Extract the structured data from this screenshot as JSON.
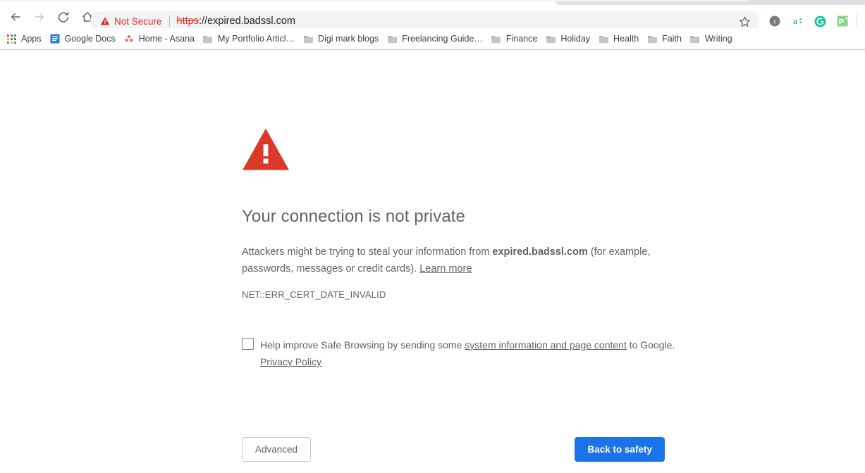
{
  "browser": {
    "nav": {
      "back_label": "Back",
      "forward_label": "Forward",
      "reload_label": "Reload",
      "home_label": "Home"
    },
    "omnibox": {
      "security_label": "Not Secure",
      "url_scheme": "https",
      "url_rest": "://expired.badssl.com",
      "full_url": "https://expired.badssl.com",
      "security_color": "#d93025"
    },
    "star_label": "Bookmark this tab",
    "extensions": [
      {
        "name": "grammarly-dark-icon",
        "glyph": "ŧ"
      },
      {
        "name": "amazon-assistant-icon",
        "glyph": "a"
      },
      {
        "name": "grammarly-icon",
        "glyph": "G"
      },
      {
        "name": "pinterest-save-icon",
        "glyph": "P"
      }
    ],
    "bookmarks": [
      {
        "label": "Apps",
        "icon": "apps-grid-icon"
      },
      {
        "label": "Google Docs",
        "icon": "google-docs-icon"
      },
      {
        "label": "Home - Asana",
        "icon": "asana-icon"
      },
      {
        "label": "My Portfolio Articl…",
        "icon": "folder-icon"
      },
      {
        "label": "Digi mark blogs",
        "icon": "folder-icon"
      },
      {
        "label": "Freelancing Guide…",
        "icon": "folder-icon"
      },
      {
        "label": "Finance",
        "icon": "folder-icon"
      },
      {
        "label": "Holiday",
        "icon": "folder-icon"
      },
      {
        "label": "Health",
        "icon": "folder-icon"
      },
      {
        "label": "Faith",
        "icon": "folder-icon"
      },
      {
        "label": "Writing",
        "icon": "folder-icon"
      }
    ]
  },
  "interstitial": {
    "icon": "red-warning-triangle-icon",
    "icon_color": "#db3a2b",
    "heading": "Your connection is not private",
    "body_part1": "Attackers might be trying to steal your information from ",
    "body_domain": "expired.badssl.com",
    "body_part2": " (for example, passwords, messages or credit cards). ",
    "learn_more": "Learn more",
    "error_code": "NET::ERR_CERT_DATE_INVALID",
    "optin_part1": "Help improve Safe Browsing by sending some ",
    "optin_link": "system information and page content",
    "optin_part2": " to Google. ",
    "privacy_policy": "Privacy Policy",
    "optin_checked": false,
    "advanced_label": "Advanced",
    "back_to_safety_label": "Back to safety",
    "primary_color": "#1a73e8"
  }
}
